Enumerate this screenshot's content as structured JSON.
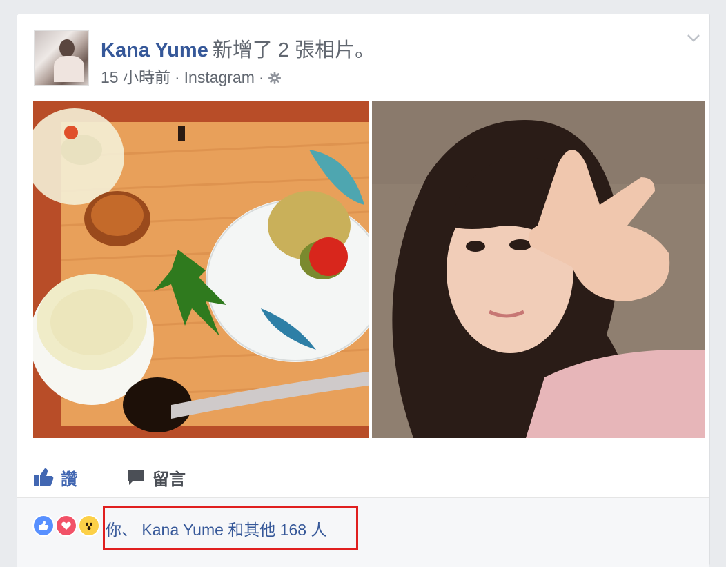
{
  "post": {
    "author": "Kana Yume",
    "action": "新增了 2 張相片。",
    "time": "15 小時前",
    "source": "Instagram",
    "sep1": "·",
    "sep2": "·",
    "privacy_icon": "gear-icon",
    "menu_icon": "chevron-down-icon"
  },
  "photos": [
    {
      "subject": "kaiseki-food-tray"
    },
    {
      "subject": "selfie-peace-sign"
    }
  ],
  "actions": {
    "like_label": "讚",
    "comment_label": "留言"
  },
  "reactions": {
    "icons": [
      "like-reaction-icon",
      "love-reaction-icon",
      "wow-reaction-icon"
    ],
    "summary": "你、 Kana Yume 和其他 168 人"
  },
  "colors": {
    "link": "#365899",
    "like_blue": "#4267b2",
    "highlight_red": "#e01f1f",
    "meta_gray": "#616770"
  }
}
